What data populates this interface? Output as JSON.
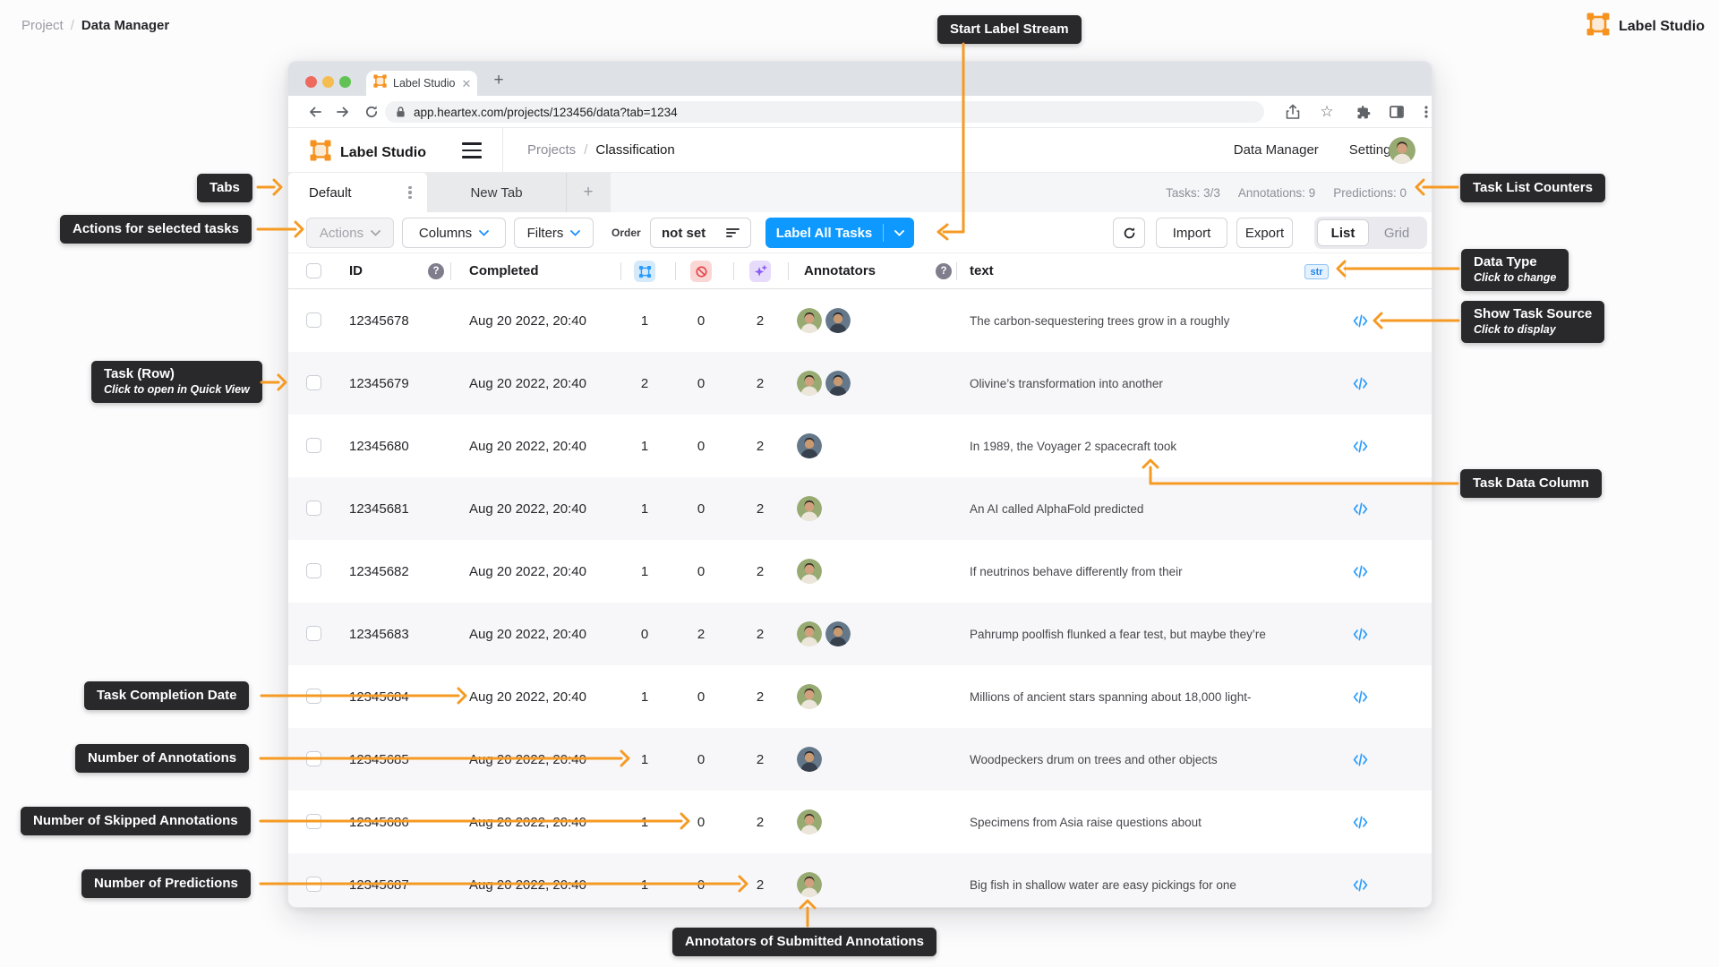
{
  "page": {
    "breadcrumb": {
      "parent": "Project",
      "separator": "/",
      "current": "Data Manager"
    },
    "brand": "Label Studio"
  },
  "browser": {
    "tab_title": "Label Studio",
    "url": "app.heartex.com/projects/123456/data?tab=1234"
  },
  "app": {
    "header": {
      "brand": "Label Studio",
      "breadcrumb_parent": "Projects",
      "breadcrumb_separator": "/",
      "breadcrumb_current": "Classification",
      "nav_data_manager": "Data Manager",
      "nav_settings": "Settings"
    },
    "tabs": {
      "active": "Default",
      "inactive": "New Tab",
      "add": "+",
      "counters": [
        "Tasks: 3/3",
        "Annotations: 9",
        "Predictions: 0"
      ]
    },
    "toolbar": {
      "actions": "Actions",
      "columns": "Columns",
      "filters": "Filters",
      "order_label": "Order",
      "order_value": "not set",
      "label_all_tasks": "Label All Tasks",
      "import": "Import",
      "export": "Export",
      "view_list": "List",
      "view_grid": "Grid"
    },
    "table": {
      "headers": {
        "id": "ID",
        "completed": "Completed",
        "annotators": "Annotators",
        "text": "text",
        "type_badge": "str"
      },
      "rows": [
        {
          "id": "12345678",
          "completed": "Aug 20 2022, 20:40",
          "annotations": "1",
          "skipped": "0",
          "predictions": "2",
          "annotators": [
            "woman",
            "man"
          ],
          "text": "The carbon-sequestering trees grow in a roughly"
        },
        {
          "id": "12345679",
          "completed": "Aug 20 2022, 20:40",
          "annotations": "2",
          "skipped": "0",
          "predictions": "2",
          "annotators": [
            "woman",
            "man"
          ],
          "text": "Olivine’s transformation into another"
        },
        {
          "id": "12345680",
          "completed": "Aug 20 2022, 20:40",
          "annotations": "1",
          "skipped": "0",
          "predictions": "2",
          "annotators": [
            "man"
          ],
          "text": "In 1989, the Voyager 2 spacecraft took"
        },
        {
          "id": "12345681",
          "completed": "Aug 20 2022, 20:40",
          "annotations": "1",
          "skipped": "0",
          "predictions": "2",
          "annotators": [
            "woman"
          ],
          "text": "An AI called AlphaFold predicted"
        },
        {
          "id": "12345682",
          "completed": "Aug 20 2022, 20:40",
          "annotations": "1",
          "skipped": "0",
          "predictions": "2",
          "annotators": [
            "woman"
          ],
          "text": "If neutrinos behave differently from their"
        },
        {
          "id": "12345683",
          "completed": "Aug 20 2022, 20:40",
          "annotations": "0",
          "skipped": "2",
          "predictions": "2",
          "annotators": [
            "woman",
            "man"
          ],
          "text": "Pahrump poolfish flunked a fear test, but maybe they’re"
        },
        {
          "id": "12345684",
          "completed": "Aug 20 2022, 20:40",
          "annotations": "1",
          "skipped": "0",
          "predictions": "2",
          "annotators": [
            "woman"
          ],
          "text": "Millions of ancient stars spanning about 18,000 light-"
        },
        {
          "id": "12345685",
          "completed": "Aug 20 2022, 20:40",
          "annotations": "1",
          "skipped": "0",
          "predictions": "2",
          "annotators": [
            "man"
          ],
          "text": "Woodpeckers drum on trees and other objects"
        },
        {
          "id": "12345686",
          "completed": "Aug 20 2022, 20:40",
          "annotations": "1",
          "skipped": "0",
          "predictions": "2",
          "annotators": [
            "woman"
          ],
          "text": "Specimens from Asia raise questions about"
        },
        {
          "id": "12345687",
          "completed": "Aug 20 2022, 20:40",
          "annotations": "1",
          "skipped": "0",
          "predictions": "2",
          "annotators": [
            "woman"
          ],
          "text": "Big fish in shallow water are easy pickings for one"
        }
      ]
    }
  },
  "callouts": {
    "start_label_stream": {
      "title": "Start Label Stream"
    },
    "tabs": {
      "title": "Tabs"
    },
    "actions": {
      "title": "Actions for selected tasks"
    },
    "task_list_counters": {
      "title": "Task List Counters"
    },
    "data_type": {
      "title": "Data Type",
      "subtitle": "Click to change"
    },
    "show_task_source": {
      "title": "Show Task Source",
      "subtitle": "Click to display"
    },
    "task_row": {
      "title": "Task (Row)",
      "subtitle": "Click to open in Quick View"
    },
    "task_data_column": {
      "title": "Task Data Column"
    },
    "task_completion_date": {
      "title": "Task Completion Date"
    },
    "number_of_annotations": {
      "title": "Number of Annotations"
    },
    "number_of_skipped_annotations": {
      "title": "Number of Skipped Annotations"
    },
    "number_of_predictions": {
      "title": "Number of Predictions"
    },
    "annotators_of_submitted": {
      "title": "Annotators of Submitted Annotations"
    }
  },
  "colors": {
    "accent_orange": "#F59A23",
    "primary_blue": "#0D99FF",
    "logo_orange": "#F6921E",
    "callout_bg": "#29282B"
  }
}
